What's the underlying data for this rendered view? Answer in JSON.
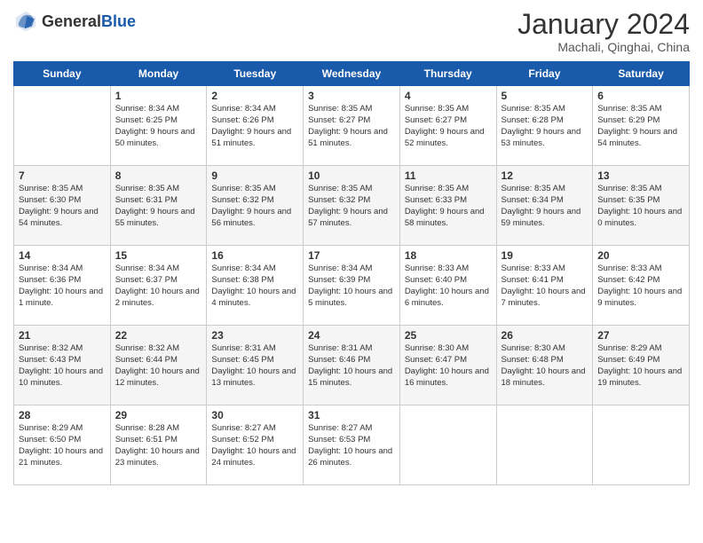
{
  "header": {
    "logo_general": "General",
    "logo_blue": "Blue",
    "month_year": "January 2024",
    "location": "Machali, Qinghai, China"
  },
  "days_of_week": [
    "Sunday",
    "Monday",
    "Tuesday",
    "Wednesday",
    "Thursday",
    "Friday",
    "Saturday"
  ],
  "weeks": [
    [
      {
        "day": "",
        "text": ""
      },
      {
        "day": "1",
        "text": "Sunrise: 8:34 AM\nSunset: 6:25 PM\nDaylight: 9 hours and 50 minutes."
      },
      {
        "day": "2",
        "text": "Sunrise: 8:34 AM\nSunset: 6:26 PM\nDaylight: 9 hours and 51 minutes."
      },
      {
        "day": "3",
        "text": "Sunrise: 8:35 AM\nSunset: 6:27 PM\nDaylight: 9 hours and 51 minutes."
      },
      {
        "day": "4",
        "text": "Sunrise: 8:35 AM\nSunset: 6:27 PM\nDaylight: 9 hours and 52 minutes."
      },
      {
        "day": "5",
        "text": "Sunrise: 8:35 AM\nSunset: 6:28 PM\nDaylight: 9 hours and 53 minutes."
      },
      {
        "day": "6",
        "text": "Sunrise: 8:35 AM\nSunset: 6:29 PM\nDaylight: 9 hours and 54 minutes."
      }
    ],
    [
      {
        "day": "7",
        "text": "Sunrise: 8:35 AM\nSunset: 6:30 PM\nDaylight: 9 hours and 54 minutes."
      },
      {
        "day": "8",
        "text": "Sunrise: 8:35 AM\nSunset: 6:31 PM\nDaylight: 9 hours and 55 minutes."
      },
      {
        "day": "9",
        "text": "Sunrise: 8:35 AM\nSunset: 6:32 PM\nDaylight: 9 hours and 56 minutes."
      },
      {
        "day": "10",
        "text": "Sunrise: 8:35 AM\nSunset: 6:32 PM\nDaylight: 9 hours and 57 minutes."
      },
      {
        "day": "11",
        "text": "Sunrise: 8:35 AM\nSunset: 6:33 PM\nDaylight: 9 hours and 58 minutes."
      },
      {
        "day": "12",
        "text": "Sunrise: 8:35 AM\nSunset: 6:34 PM\nDaylight: 9 hours and 59 minutes."
      },
      {
        "day": "13",
        "text": "Sunrise: 8:35 AM\nSunset: 6:35 PM\nDaylight: 10 hours and 0 minutes."
      }
    ],
    [
      {
        "day": "14",
        "text": "Sunrise: 8:34 AM\nSunset: 6:36 PM\nDaylight: 10 hours and 1 minute."
      },
      {
        "day": "15",
        "text": "Sunrise: 8:34 AM\nSunset: 6:37 PM\nDaylight: 10 hours and 2 minutes."
      },
      {
        "day": "16",
        "text": "Sunrise: 8:34 AM\nSunset: 6:38 PM\nDaylight: 10 hours and 4 minutes."
      },
      {
        "day": "17",
        "text": "Sunrise: 8:34 AM\nSunset: 6:39 PM\nDaylight: 10 hours and 5 minutes."
      },
      {
        "day": "18",
        "text": "Sunrise: 8:33 AM\nSunset: 6:40 PM\nDaylight: 10 hours and 6 minutes."
      },
      {
        "day": "19",
        "text": "Sunrise: 8:33 AM\nSunset: 6:41 PM\nDaylight: 10 hours and 7 minutes."
      },
      {
        "day": "20",
        "text": "Sunrise: 8:33 AM\nSunset: 6:42 PM\nDaylight: 10 hours and 9 minutes."
      }
    ],
    [
      {
        "day": "21",
        "text": "Sunrise: 8:32 AM\nSunset: 6:43 PM\nDaylight: 10 hours and 10 minutes."
      },
      {
        "day": "22",
        "text": "Sunrise: 8:32 AM\nSunset: 6:44 PM\nDaylight: 10 hours and 12 minutes."
      },
      {
        "day": "23",
        "text": "Sunrise: 8:31 AM\nSunset: 6:45 PM\nDaylight: 10 hours and 13 minutes."
      },
      {
        "day": "24",
        "text": "Sunrise: 8:31 AM\nSunset: 6:46 PM\nDaylight: 10 hours and 15 minutes."
      },
      {
        "day": "25",
        "text": "Sunrise: 8:30 AM\nSunset: 6:47 PM\nDaylight: 10 hours and 16 minutes."
      },
      {
        "day": "26",
        "text": "Sunrise: 8:30 AM\nSunset: 6:48 PM\nDaylight: 10 hours and 18 minutes."
      },
      {
        "day": "27",
        "text": "Sunrise: 8:29 AM\nSunset: 6:49 PM\nDaylight: 10 hours and 19 minutes."
      }
    ],
    [
      {
        "day": "28",
        "text": "Sunrise: 8:29 AM\nSunset: 6:50 PM\nDaylight: 10 hours and 21 minutes."
      },
      {
        "day": "29",
        "text": "Sunrise: 8:28 AM\nSunset: 6:51 PM\nDaylight: 10 hours and 23 minutes."
      },
      {
        "day": "30",
        "text": "Sunrise: 8:27 AM\nSunset: 6:52 PM\nDaylight: 10 hours and 24 minutes."
      },
      {
        "day": "31",
        "text": "Sunrise: 8:27 AM\nSunset: 6:53 PM\nDaylight: 10 hours and 26 minutes."
      },
      {
        "day": "",
        "text": ""
      },
      {
        "day": "",
        "text": ""
      },
      {
        "day": "",
        "text": ""
      }
    ]
  ]
}
